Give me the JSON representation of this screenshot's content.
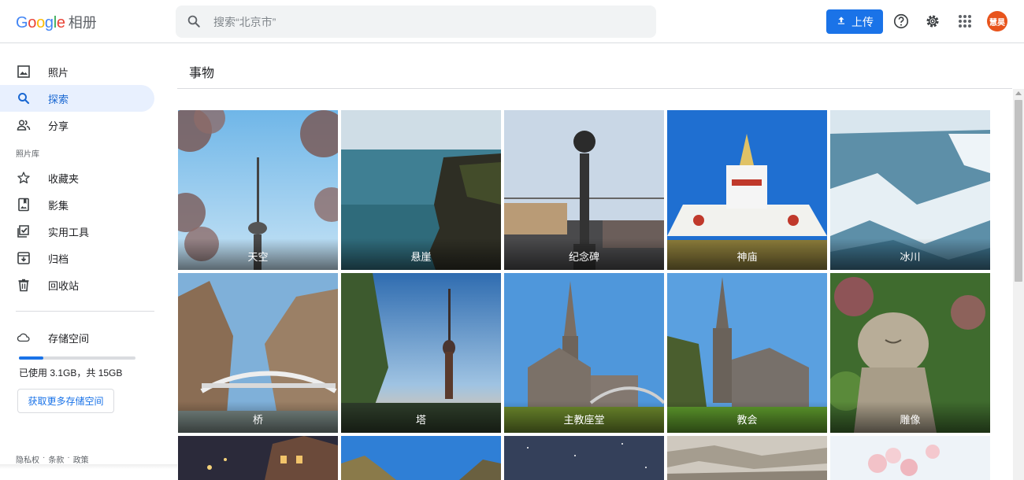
{
  "header": {
    "logo_google": "Google",
    "logo_product": "相册",
    "search_placeholder": "搜索“北京市”",
    "upload_label": "上传",
    "avatar_text": "慧昊",
    "accent": "#1a73e8",
    "avatar_color": "#e8541c"
  },
  "sidebar": {
    "items": [
      {
        "label": "照片",
        "icon": "photo-icon"
      },
      {
        "label": "探索",
        "icon": "search-icon",
        "active": true
      },
      {
        "label": "分享",
        "icon": "people-icon"
      }
    ],
    "library_label": "照片库",
    "library_items": [
      {
        "label": "收藏夹",
        "icon": "star-icon"
      },
      {
        "label": "影集",
        "icon": "album-icon"
      },
      {
        "label": "实用工具",
        "icon": "utilities-icon"
      },
      {
        "label": "归档",
        "icon": "archive-icon"
      },
      {
        "label": "回收站",
        "icon": "trash-icon"
      }
    ],
    "storage": {
      "label": "存储空间",
      "usage_text": "已使用 3.1GB，共 15GB",
      "used_fraction": 0.207,
      "get_more_label": "获取更多存储空间"
    },
    "footer": [
      "隐私权",
      "·",
      "条款",
      "·",
      "政策"
    ]
  },
  "main": {
    "title": "事物",
    "tiles": [
      {
        "caption": "天空",
        "scene": "tower-blossom"
      },
      {
        "caption": "悬崖",
        "scene": "cliff"
      },
      {
        "caption": "纪念碑",
        "scene": "monument"
      },
      {
        "caption": "神庙",
        "scene": "stupa"
      },
      {
        "caption": "冰川",
        "scene": "glacier"
      },
      {
        "caption": "桥",
        "scene": "gorge-bridge"
      },
      {
        "caption": "塔",
        "scene": "tower-sunset"
      },
      {
        "caption": "主教座堂",
        "scene": "cathedral"
      },
      {
        "caption": "教会",
        "scene": "church"
      },
      {
        "caption": "雕像",
        "scene": "statue"
      },
      {
        "caption": "",
        "scene": "town-night"
      },
      {
        "caption": "",
        "scene": "mountain-sky"
      },
      {
        "caption": "",
        "scene": "night-sky"
      },
      {
        "caption": "",
        "scene": "rocks"
      },
      {
        "caption": "",
        "scene": "blossom"
      }
    ]
  }
}
